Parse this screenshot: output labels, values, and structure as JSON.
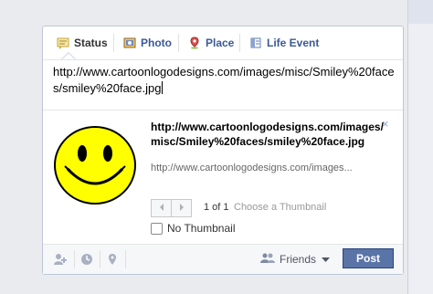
{
  "tabs": [
    {
      "label": "Status",
      "icon": "status-icon"
    },
    {
      "label": "Photo",
      "icon": "photo-icon"
    },
    {
      "label": "Place",
      "icon": "place-icon"
    },
    {
      "label": "Life Event",
      "icon": "life-event-icon"
    }
  ],
  "composer": {
    "text": "http://www.cartoonlogodesigns.com/images/misc/Smiley%20faces/smiley%20face.jpg"
  },
  "preview": {
    "title": "http://www.cartoonlogodesigns.com/images/misc/Smiley%20faces/smiley%20face.jpg",
    "url": "http://www.cartoonlogodesigns.com/images...",
    "pager_count": "1 of 1",
    "pager_hint": "Choose a Thumbnail",
    "no_thumbnail_label": "No Thumbnail",
    "close": "×"
  },
  "footer": {
    "audience_label": "Friends",
    "post_label": "Post"
  },
  "colors": {
    "link": "#3b5998",
    "post_button": "#5b74a8",
    "smiley_fill": "#ffff00"
  }
}
